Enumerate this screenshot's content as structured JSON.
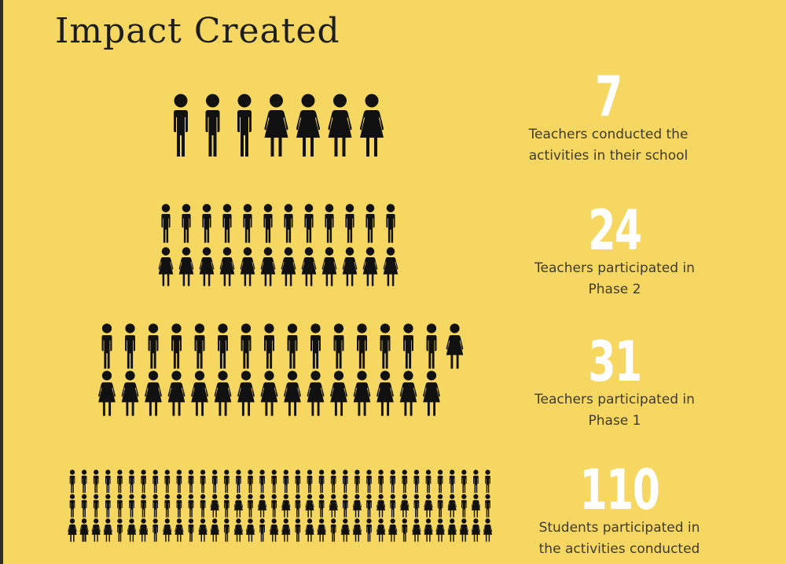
{
  "page": {
    "title": "Impact Created"
  },
  "colors": {
    "background": "#f6d762",
    "figure": "#111111",
    "number": "#ffffff",
    "caption": "#3f3a2a"
  },
  "stats": [
    {
      "number": "7",
      "caption_line1": "Teachers conducted the",
      "caption_line2": "activities in their school",
      "male": 3,
      "female": 4,
      "icon_set": "teacher-figures"
    },
    {
      "number": "24",
      "caption_line1": "Teachers participated in",
      "caption_line2": "Phase 2",
      "male": 12,
      "female": 12,
      "icon_set": "teacher-figures"
    },
    {
      "number": "31",
      "caption_line1": "Teachers participated in",
      "caption_line2": "Phase 1",
      "male": 15,
      "female": 16,
      "icon_set": "teacher-figures"
    },
    {
      "number": "110",
      "caption_line1": "Students participated in",
      "caption_line2": "the activities conducted",
      "male": 70,
      "female": 40,
      "icon_set": "student-figures"
    }
  ]
}
